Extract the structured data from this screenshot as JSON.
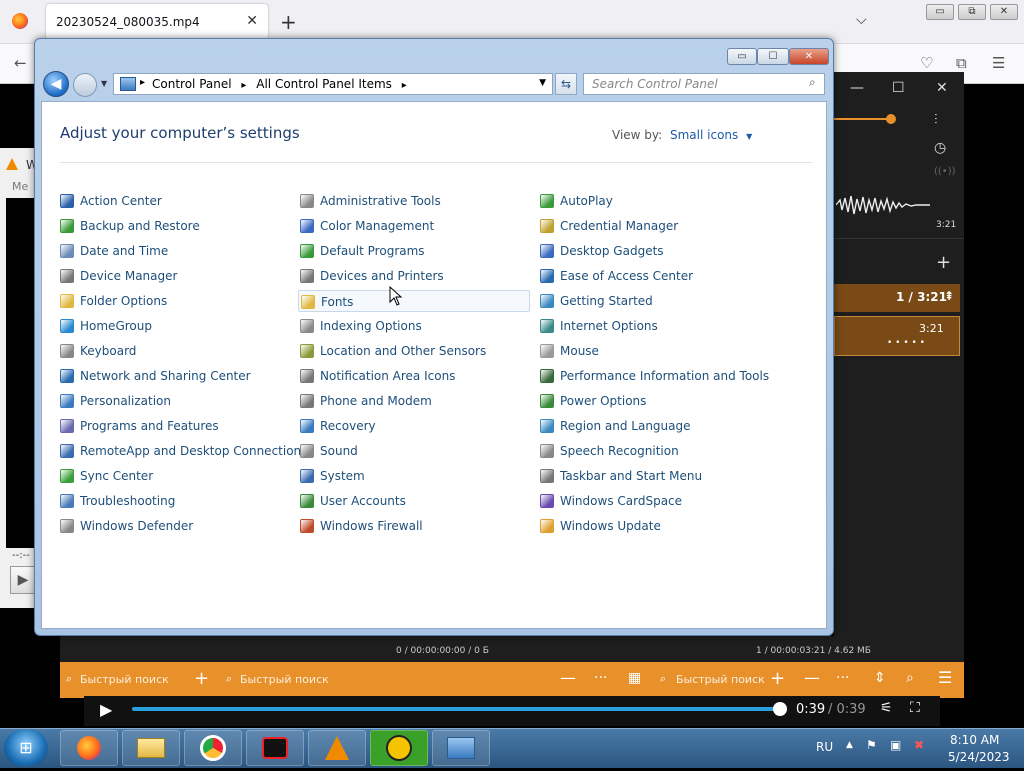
{
  "browser": {
    "tab_title": "20230524_080035.mp4",
    "tab_close": "✕",
    "new_tab": "+",
    "tab_list": "⌵",
    "win_min": "▭",
    "win_restore": "⧉",
    "win_close": "✕"
  },
  "control_panel": {
    "breadcrumb": [
      "Control Panel",
      "All Control Panel Items"
    ],
    "search_placeholder": "Search Control Panel",
    "heading": "Adjust your computer’s settings",
    "view_by_label": "View by:",
    "view_by_value": "Small icons",
    "columns": [
      [
        {
          "label": "Action Center",
          "icon": "flag-icon",
          "color": "#2a5faa"
        },
        {
          "label": "Backup and Restore",
          "icon": "backup-icon",
          "color": "#3a9a3a"
        },
        {
          "label": "Date and Time",
          "icon": "clock-icon",
          "color": "#6a8ab8"
        },
        {
          "label": "Device Manager",
          "icon": "printer-icon",
          "color": "#777777"
        },
        {
          "label": "Folder Options",
          "icon": "folder-icon",
          "color": "#e0b840"
        },
        {
          "label": "HomeGroup",
          "icon": "homegroup-icon",
          "color": "#2a8ad0"
        },
        {
          "label": "Keyboard",
          "icon": "keyboard-icon",
          "color": "#888888"
        },
        {
          "label": "Network and Sharing Center",
          "icon": "network-icon",
          "color": "#2a6ab0"
        },
        {
          "label": "Personalization",
          "icon": "monitor-icon",
          "color": "#3a7ac0"
        },
        {
          "label": "Programs and Features",
          "icon": "programs-icon",
          "color": "#6a6ab0"
        },
        {
          "label": "RemoteApp and Desktop Connections",
          "icon": "remote-icon",
          "color": "#3a6ab0"
        },
        {
          "label": "Sync Center",
          "icon": "sync-icon",
          "color": "#3aa03a"
        },
        {
          "label": "Troubleshooting",
          "icon": "troubleshoot-icon",
          "color": "#4a7ab8"
        },
        {
          "label": "Windows Defender",
          "icon": "defender-icon",
          "color": "#888888"
        }
      ],
      [
        {
          "label": "Administrative Tools",
          "icon": "admin-tools-icon",
          "color": "#888888"
        },
        {
          "label": "Color Management",
          "icon": "color-mgmt-icon",
          "color": "#3a6ac0"
        },
        {
          "label": "Default Programs",
          "icon": "default-programs-icon",
          "color": "#3a9a3a"
        },
        {
          "label": "Devices and Printers",
          "icon": "printer-icon",
          "color": "#777777"
        },
        {
          "label": "Fonts",
          "icon": "fonts-folder-icon",
          "color": "#e0b840"
        },
        {
          "label": "Indexing Options",
          "icon": "indexing-icon",
          "color": "#8a8a8a"
        },
        {
          "label": "Location and Other Sensors",
          "icon": "sensor-icon",
          "color": "#8a9a3a"
        },
        {
          "label": "Notification Area Icons",
          "icon": "notification-icon",
          "color": "#777777"
        },
        {
          "label": "Phone and Modem",
          "icon": "phone-icon",
          "color": "#777777"
        },
        {
          "label": "Recovery",
          "icon": "recovery-icon",
          "color": "#3a7ac0"
        },
        {
          "label": "Sound",
          "icon": "speaker-icon",
          "color": "#888888"
        },
        {
          "label": "System",
          "icon": "system-icon",
          "color": "#3a6ab0"
        },
        {
          "label": "User Accounts",
          "icon": "users-icon",
          "color": "#3a8a3a"
        },
        {
          "label": "Windows Firewall",
          "icon": "firewall-icon",
          "color": "#c04a2a"
        }
      ],
      [
        {
          "label": "AutoPlay",
          "icon": "autoplay-icon",
          "color": "#3a9a3a"
        },
        {
          "label": "Credential Manager",
          "icon": "credential-icon",
          "color": "#c0a030"
        },
        {
          "label": "Desktop Gadgets",
          "icon": "gadgets-icon",
          "color": "#3a6ac0"
        },
        {
          "label": "Ease of Access Center",
          "icon": "ease-access-icon",
          "color": "#2a6ab0"
        },
        {
          "label": "Getting Started",
          "icon": "getting-started-icon",
          "color": "#3a8ac0"
        },
        {
          "label": "Internet Options",
          "icon": "internet-icon",
          "color": "#3a8a8a"
        },
        {
          "label": "Mouse",
          "icon": "mouse-icon",
          "color": "#999999"
        },
        {
          "label": "Performance Information and Tools",
          "icon": "performance-icon",
          "color": "#3a6a3a"
        },
        {
          "label": "Power Options",
          "icon": "power-icon",
          "color": "#3a8a3a"
        },
        {
          "label": "Region and Language",
          "icon": "region-icon",
          "color": "#3a8ac0"
        },
        {
          "label": "Speech Recognition",
          "icon": "microphone-icon",
          "color": "#888888"
        },
        {
          "label": "Taskbar and Start Menu",
          "icon": "taskbar-icon",
          "color": "#777777"
        },
        {
          "label": "Windows CardSpace",
          "icon": "cardspace-icon",
          "color": "#6a4ab0"
        },
        {
          "label": "Windows Update",
          "icon": "update-icon",
          "color": "#e0a030"
        }
      ]
    ]
  },
  "player": {
    "track_time": "3:21",
    "position": "1 / 3:21",
    "row_time": "3:21",
    "dots": "• • • • •",
    "status_left": "0 / 00:00:00:00 / 0 Б",
    "status_right": "1 / 00:00:03:21 / 4.62 МБ",
    "search_placeholder_1": "Быстрый поиск",
    "search_placeholder_2": "Быстрый поиск",
    "search_placeholder_3": "Быстрый поиск",
    "current_time": "0:39",
    "duration": "/ 0:39",
    "progress": 1.0
  },
  "left_window": {
    "label_w": "W",
    "label_me": "Me",
    "time": "--:--"
  },
  "taskbar": {
    "language": "RU",
    "time": "8:10 AM",
    "date": "5/24/2023"
  },
  "colors": {
    "accent_orange": "#e8902a",
    "link_blue": "#1e4f7a",
    "seek_blue": "#2aa0dc"
  }
}
